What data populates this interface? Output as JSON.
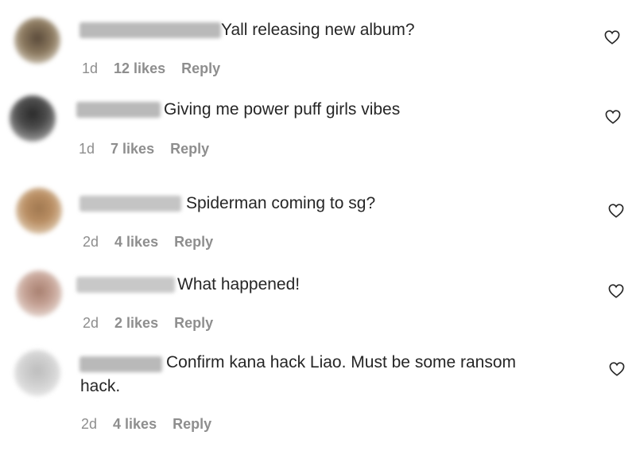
{
  "comments": [
    {
      "text": "Yall releasing new album?",
      "time": "1d",
      "likes": "12 likes",
      "reply": "Reply"
    },
    {
      "text": "Giving me power puff girls vibes",
      "time": "1d",
      "likes": "7 likes",
      "reply": "Reply"
    },
    {
      "text": "Spiderman coming to sg?",
      "time": "2d",
      "likes": "4 likes",
      "reply": "Reply"
    },
    {
      "text": "What happened!",
      "time": "2d",
      "likes": "2 likes",
      "reply": "Reply"
    },
    {
      "text": "Confirm kana hack Liao. Must be some ransom",
      "text_cont": "hack.",
      "time": "2d",
      "likes": "4 likes",
      "reply": "Reply"
    }
  ],
  "icons": {
    "like": "heart-outline-icon"
  },
  "colors": {
    "text": "#262626",
    "meta": "#8e8e8e"
  }
}
